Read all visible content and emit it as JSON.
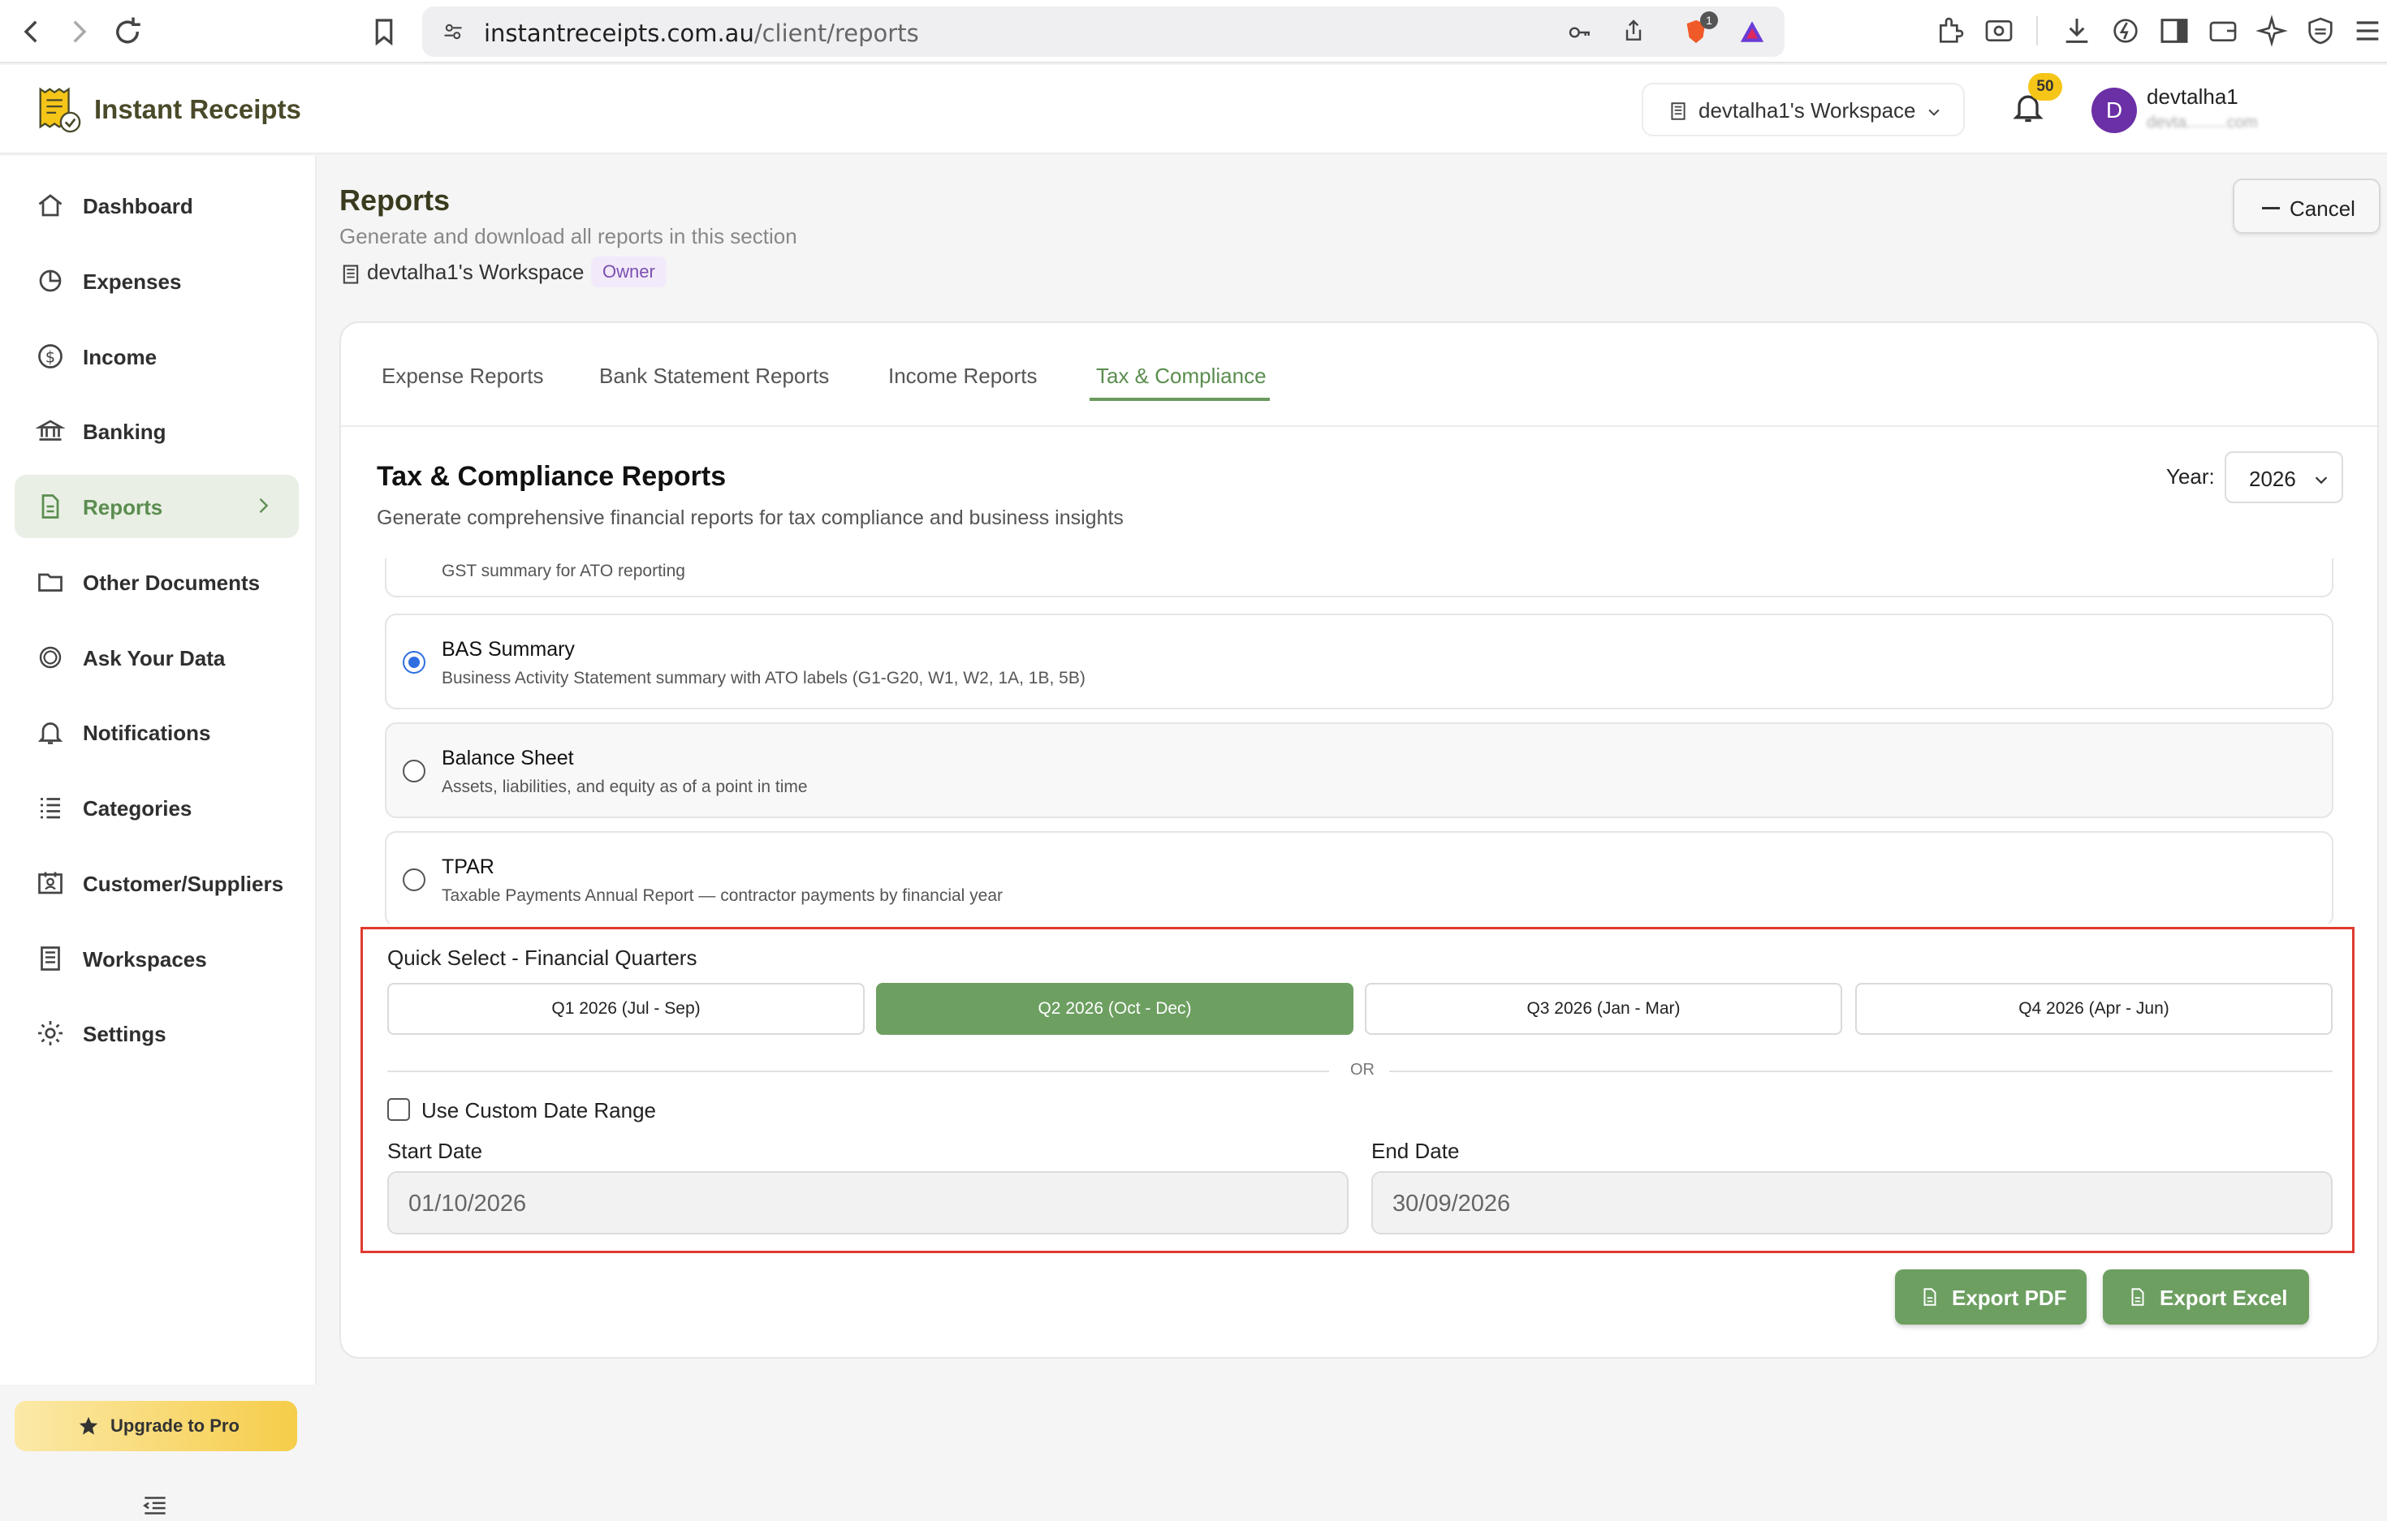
{
  "browser": {
    "url_host": "instantreceipts.com.au",
    "url_path": "/client/reports",
    "shield_badge": "1"
  },
  "header": {
    "app_name": "Instant Receipts",
    "workspace_switcher": "devtalha1's Workspace",
    "notifications_count": "50",
    "avatar_initial": "D",
    "user_name": "devtalha1",
    "user_email": "devta.........com"
  },
  "sidebar": {
    "items": [
      {
        "label": "Dashboard",
        "icon": "home-icon"
      },
      {
        "label": "Expenses",
        "icon": "pie-chart-icon"
      },
      {
        "label": "Income",
        "icon": "dollar-circle-icon"
      },
      {
        "label": "Banking",
        "icon": "bank-icon"
      },
      {
        "label": "Reports",
        "icon": "report-icon",
        "active": true
      },
      {
        "label": "Other Documents",
        "icon": "folder-icon"
      },
      {
        "label": "Ask Your Data",
        "icon": "ai-icon"
      },
      {
        "label": "Notifications",
        "icon": "bell-icon"
      },
      {
        "label": "Categories",
        "icon": "list-icon"
      },
      {
        "label": "Customer/Suppliers",
        "icon": "contacts-icon"
      },
      {
        "label": "Workspaces",
        "icon": "building-icon"
      },
      {
        "label": "Settings",
        "icon": "gear-icon"
      }
    ],
    "upgrade_label": "Upgrade to Pro"
  },
  "page": {
    "title": "Reports",
    "subtitle": "Generate and download all reports in this section",
    "workspace_name": "devtalha1's Workspace",
    "role_badge": "Owner",
    "cancel_label": "Cancel"
  },
  "tabs": [
    "Expense Reports",
    "Bank Statement Reports",
    "Income Reports",
    "Tax & Compliance"
  ],
  "active_tab": "Tax & Compliance",
  "section": {
    "title": "Tax & Compliance Reports",
    "subtitle": "Generate comprehensive financial reports for tax compliance and business insights",
    "year_label": "Year:",
    "year_value": "2026"
  },
  "reports": [
    {
      "title": "",
      "desc": "GST summary for ATO reporting"
    },
    {
      "title": "BAS Summary",
      "desc": "Business Activity Statement summary with ATO labels (G1-G20, W1, W2, 1A, 1B, 5B)",
      "selected": true
    },
    {
      "title": "Balance Sheet",
      "desc": "Assets, liabilities, and equity as of a point in time"
    },
    {
      "title": "TPAR",
      "desc": "Taxable Payments Annual Report — contractor payments by financial year"
    }
  ],
  "quick_select": {
    "title": "Quick Select - Financial Quarters",
    "quarters": [
      "Q1 2026 (Jul - Sep)",
      "Q2 2026 (Oct - Dec)",
      "Q3 2026 (Jan - Mar)",
      "Q4 2026 (Apr - Jun)"
    ],
    "active_quarter": "Q2 2026 (Oct - Dec)",
    "or_label": "OR",
    "custom_range_label": "Use Custom Date Range",
    "start_label": "Start Date",
    "start_value": "01/10/2026",
    "end_label": "End Date",
    "end_value": "30/09/2026"
  },
  "actions": {
    "export_pdf": "Export PDF",
    "export_excel": "Export Excel"
  },
  "colors": {
    "accent_green": "#6d9f61",
    "highlight_red": "#e03a2f",
    "radio_blue": "#2f6fe0"
  }
}
